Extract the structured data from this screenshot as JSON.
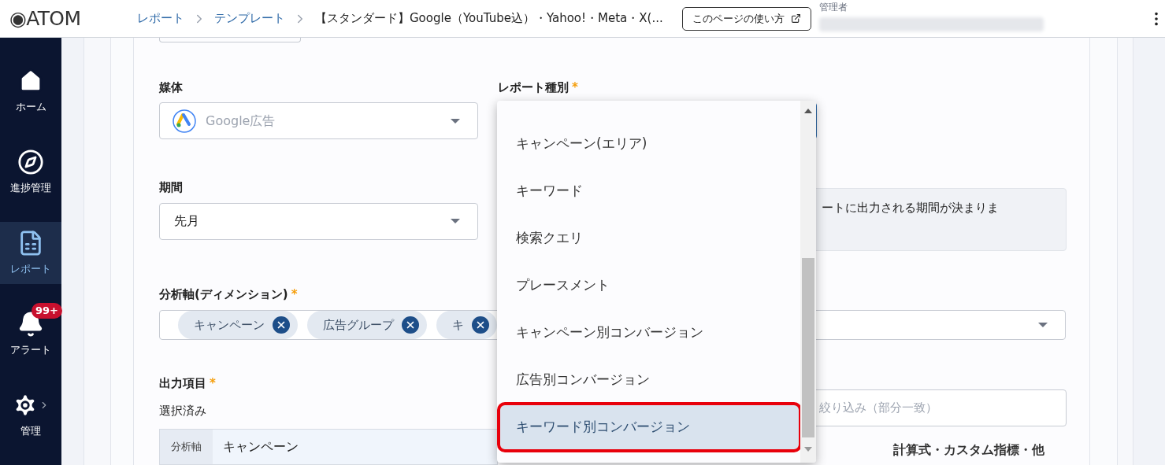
{
  "header": {
    "logo": "◉ATOM",
    "breadcrumbs": [
      {
        "label": "レポート",
        "kind": "link"
      },
      {
        "label": "テンプレート",
        "kind": "link"
      },
      {
        "label": "【スタンダード】Google（YouTube込）・Yahoo!・Meta・X(...",
        "kind": "current"
      }
    ],
    "help_button": "このページの使い方",
    "user_role": "管理者"
  },
  "sidebar": {
    "items": [
      {
        "label": "ホーム",
        "selected": false
      },
      {
        "label": "進捗管理",
        "selected": false
      },
      {
        "label": "レポート",
        "selected": true
      },
      {
        "label": "アラート",
        "selected": false,
        "badge": "99+"
      },
      {
        "label": "管理",
        "selected": false,
        "chevron": true
      }
    ]
  },
  "form": {
    "media": {
      "label": "媒体",
      "value": "Google広告"
    },
    "report_type": {
      "label": "レポート種別",
      "required_mark": "*"
    },
    "period": {
      "label": "期間",
      "value": "先月"
    },
    "period_info": "ートに出力される期間が決まりま",
    "dimensions": {
      "label": "分析軸(ディメンション)",
      "required_mark": "*",
      "chips": [
        "キャンペーン",
        "広告グループ",
        "キ"
      ]
    },
    "output": {
      "label": "出力項目",
      "required_mark": "*",
      "selected_label": "選択済み",
      "table": [
        {
          "kind": "分析軸",
          "value": "キャンペーン"
        }
      ]
    },
    "filter": {
      "placeholder": "絞り込み（部分一致）"
    },
    "metrics_heading": "計算式・カスタム指標・他"
  },
  "dropdown": {
    "items": [
      {
        "label": "キャンペーン(エリア)",
        "selected": false,
        "highlighted": false
      },
      {
        "label": "キーワード",
        "selected": false,
        "highlighted": false
      },
      {
        "label": "検索クエリ",
        "selected": false,
        "highlighted": false
      },
      {
        "label": "プレースメント",
        "selected": false,
        "highlighted": false
      },
      {
        "label": "キャンペーン別コンバージョン",
        "selected": false,
        "highlighted": false
      },
      {
        "label": "広告別コンバージョン",
        "selected": false,
        "highlighted": false
      },
      {
        "label": "キーワード別コンバージョン",
        "selected": true,
        "highlighted": true
      }
    ]
  }
}
